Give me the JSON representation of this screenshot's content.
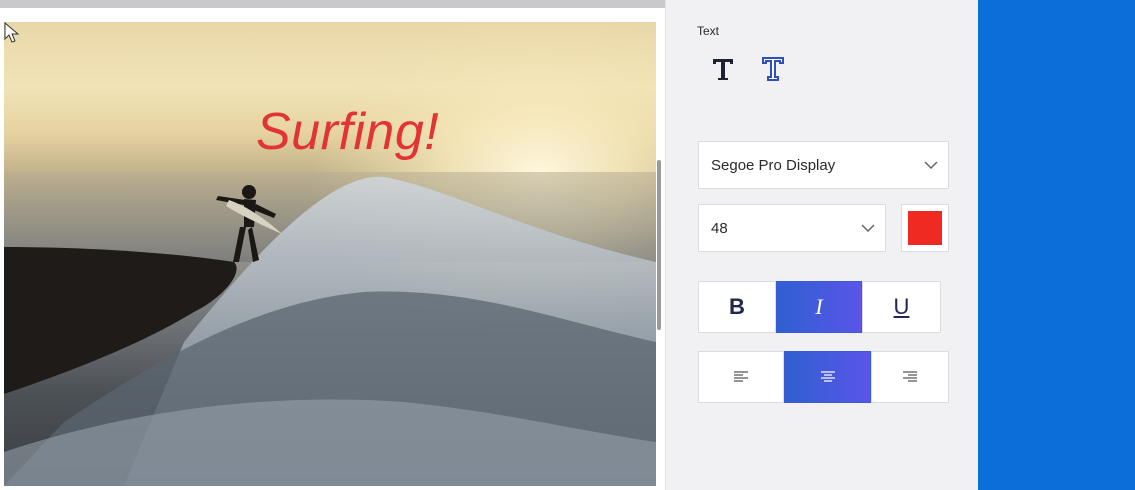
{
  "canvas": {
    "overlay_text": "Surfing!",
    "overlay_color": "#e23434"
  },
  "panel": {
    "section_label": "Text",
    "icons": [
      "text-plain-icon",
      "text-styled-icon"
    ],
    "font_family": "Segoe Pro Display",
    "font_size": "48",
    "text_color": "#ee2a22",
    "style_buttons": [
      {
        "label": "B",
        "active": false
      },
      {
        "label": "I",
        "active": true
      },
      {
        "label": "U",
        "active": false
      }
    ],
    "align_buttons": [
      {
        "name": "align-left-icon",
        "active": false
      },
      {
        "name": "align-center-icon",
        "active": true
      },
      {
        "name": "align-right-icon",
        "active": false
      }
    ]
  },
  "colors": {
    "accent_blue": "#0a6fd8",
    "active_button": "#3d5ad6"
  }
}
